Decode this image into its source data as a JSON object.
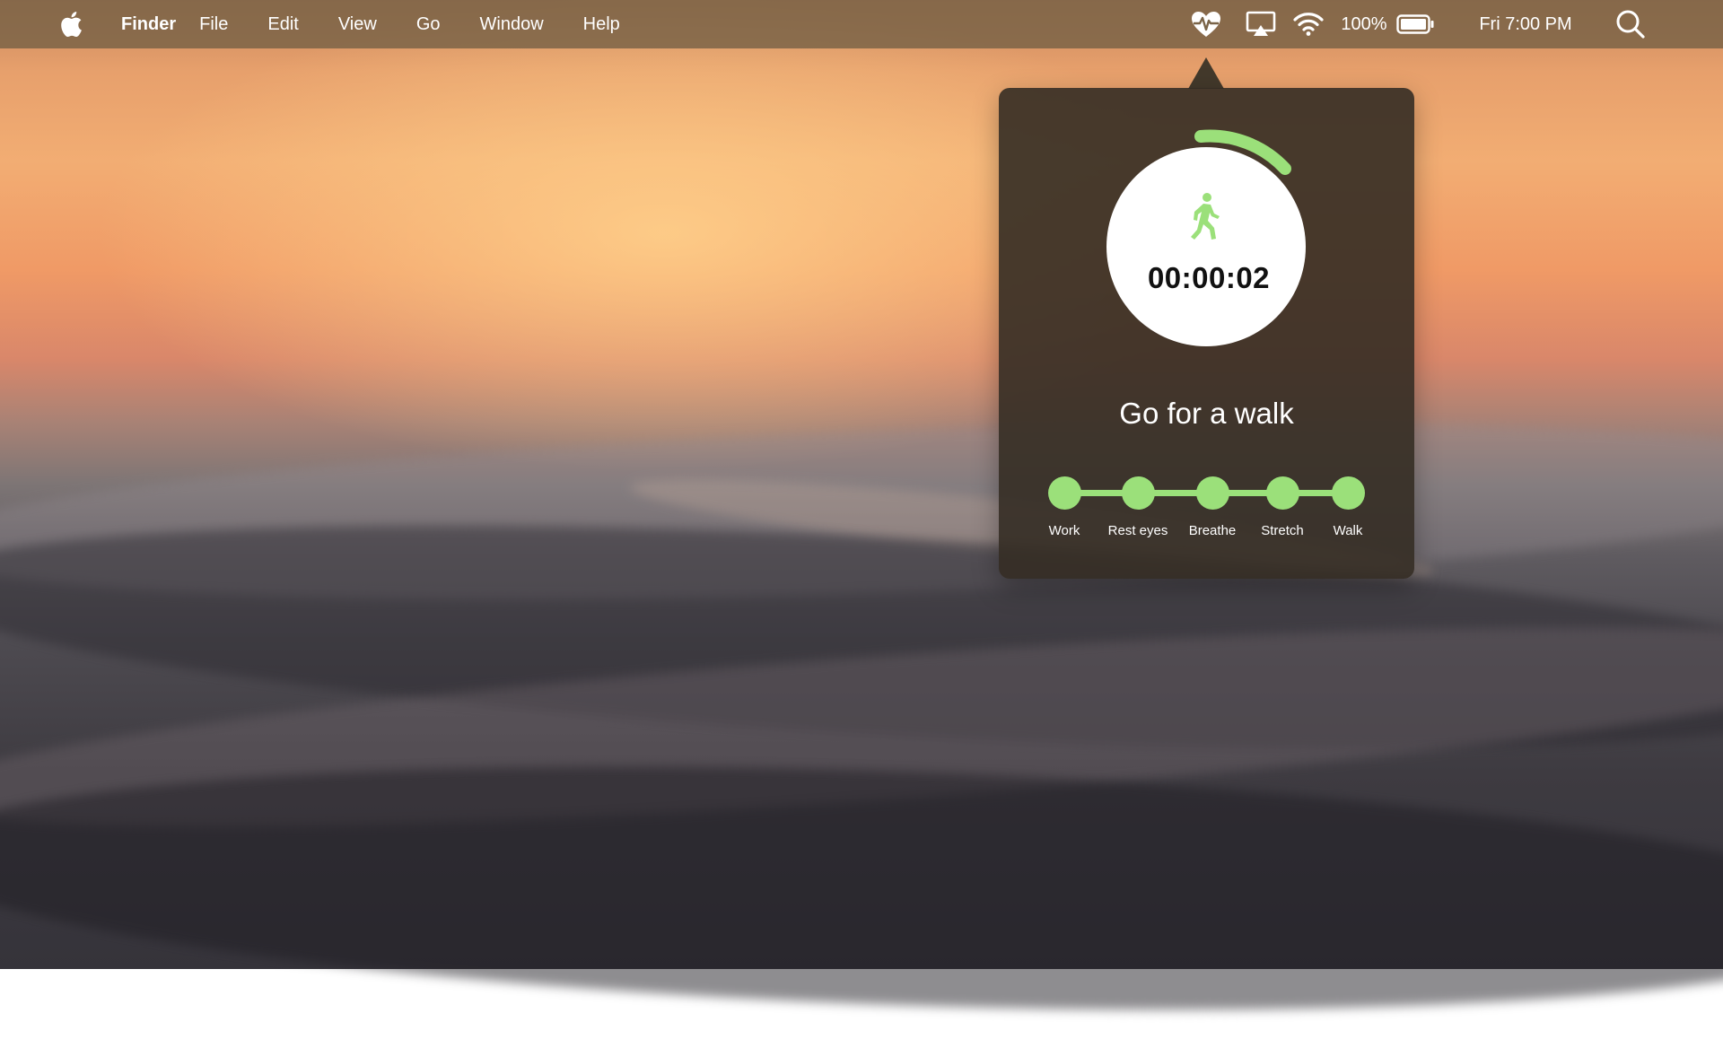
{
  "menubar": {
    "apple_icon": "apple-logo-icon",
    "app_name": "Finder",
    "menus": [
      "File",
      "Edit",
      "View",
      "Go",
      "Window",
      "Help"
    ],
    "status": {
      "health_icon": "heart-pulse-icon",
      "airplay_icon": "airplay-icon",
      "wifi_icon": "wifi-icon",
      "battery_percent": "100%",
      "battery_icon": "battery-full-icon",
      "clock": "Fri 7:00 PM",
      "search_icon": "spotlight-search-icon"
    }
  },
  "popover": {
    "timer": "00:00:02",
    "activity_icon": "walking-person-icon",
    "activity_title": "Go for a walk",
    "accent_color": "#9be07a",
    "steps": [
      "Work",
      "Rest eyes",
      "Breathe",
      "Stretch",
      "Walk"
    ]
  }
}
